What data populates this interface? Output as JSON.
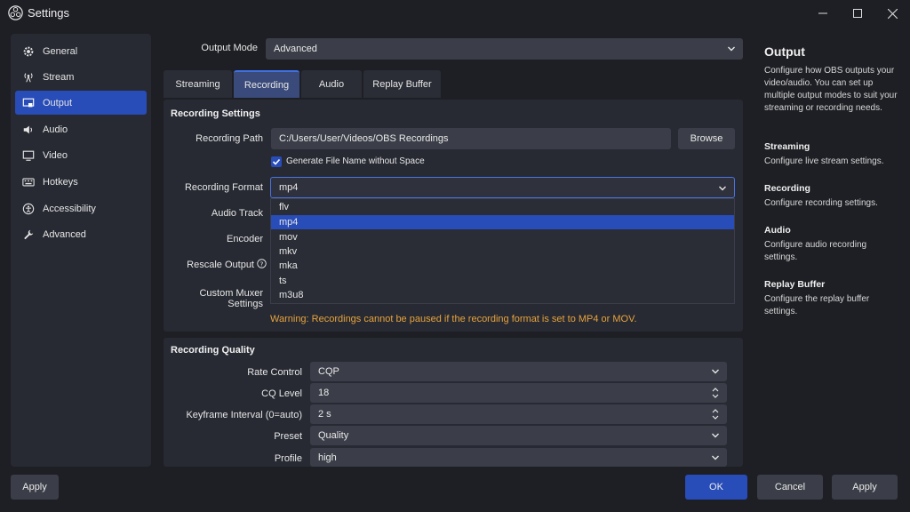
{
  "window": {
    "title": "Settings"
  },
  "sidebar": {
    "items": [
      {
        "label": "General",
        "icon": "gear-icon"
      },
      {
        "label": "Stream",
        "icon": "broadcast-icon"
      },
      {
        "label": "Output",
        "icon": "output-icon"
      },
      {
        "label": "Audio",
        "icon": "speaker-icon"
      },
      {
        "label": "Video",
        "icon": "monitor-icon"
      },
      {
        "label": "Hotkeys",
        "icon": "keyboard-icon"
      },
      {
        "label": "Accessibility",
        "icon": "accessibility-icon"
      },
      {
        "label": "Advanced",
        "icon": "wrench-icon"
      }
    ],
    "active": "Output"
  },
  "output_mode": {
    "label": "Output Mode",
    "value": "Advanced"
  },
  "tabs": [
    "Streaming",
    "Recording",
    "Audio",
    "Replay Buffer"
  ],
  "active_tab": "Recording",
  "recording_settings": {
    "title": "Recording Settings",
    "path_label": "Recording Path",
    "path_value": "C:/Users/User/Videos/OBS Recordings",
    "browse_label": "Browse",
    "nospace_label": "Generate File Name without Space",
    "nospace_checked": true,
    "format_label": "Recording Format",
    "format_value": "mp4",
    "format_options": [
      "flv",
      "mp4",
      "mov",
      "mkv",
      "mka",
      "ts",
      "m3u8"
    ],
    "audio_track_label": "Audio Track",
    "encoder_label": "Encoder",
    "rescale_label": "Rescale Output",
    "muxer_label": "Custom Muxer Settings",
    "warning": "Warning: Recordings cannot be paused if the recording format is set to MP4 or MOV."
  },
  "recording_quality": {
    "title": "Recording Quality",
    "rate_control_label": "Rate Control",
    "rate_control_value": "CQP",
    "cq_level_label": "CQ Level",
    "cq_level_value": "18",
    "keyframe_label": "Keyframe Interval (0=auto)",
    "keyframe_value": "2 s",
    "preset_label": "Preset",
    "preset_value": "Quality",
    "profile_label": "Profile",
    "profile_value": "high"
  },
  "help": {
    "title": "Output",
    "intro": "Configure how OBS outputs your video/audio. You can set up multiple output modes to suit your streaming or recording needs.",
    "sections": [
      {
        "title": "Streaming",
        "text": "Configure live stream settings."
      },
      {
        "title": "Recording",
        "text": "Configure recording settings."
      },
      {
        "title": "Audio",
        "text": "Configure audio recording settings."
      },
      {
        "title": "Replay Buffer",
        "text": "Configure the replay buffer settings."
      }
    ]
  },
  "footer": {
    "apply_left": "Apply",
    "ok": "OK",
    "cancel": "Cancel",
    "apply": "Apply"
  },
  "colors": {
    "accent": "#284cb8",
    "warning": "#e8a33c",
    "background": "#1e1f24",
    "panel": "#272a33"
  }
}
